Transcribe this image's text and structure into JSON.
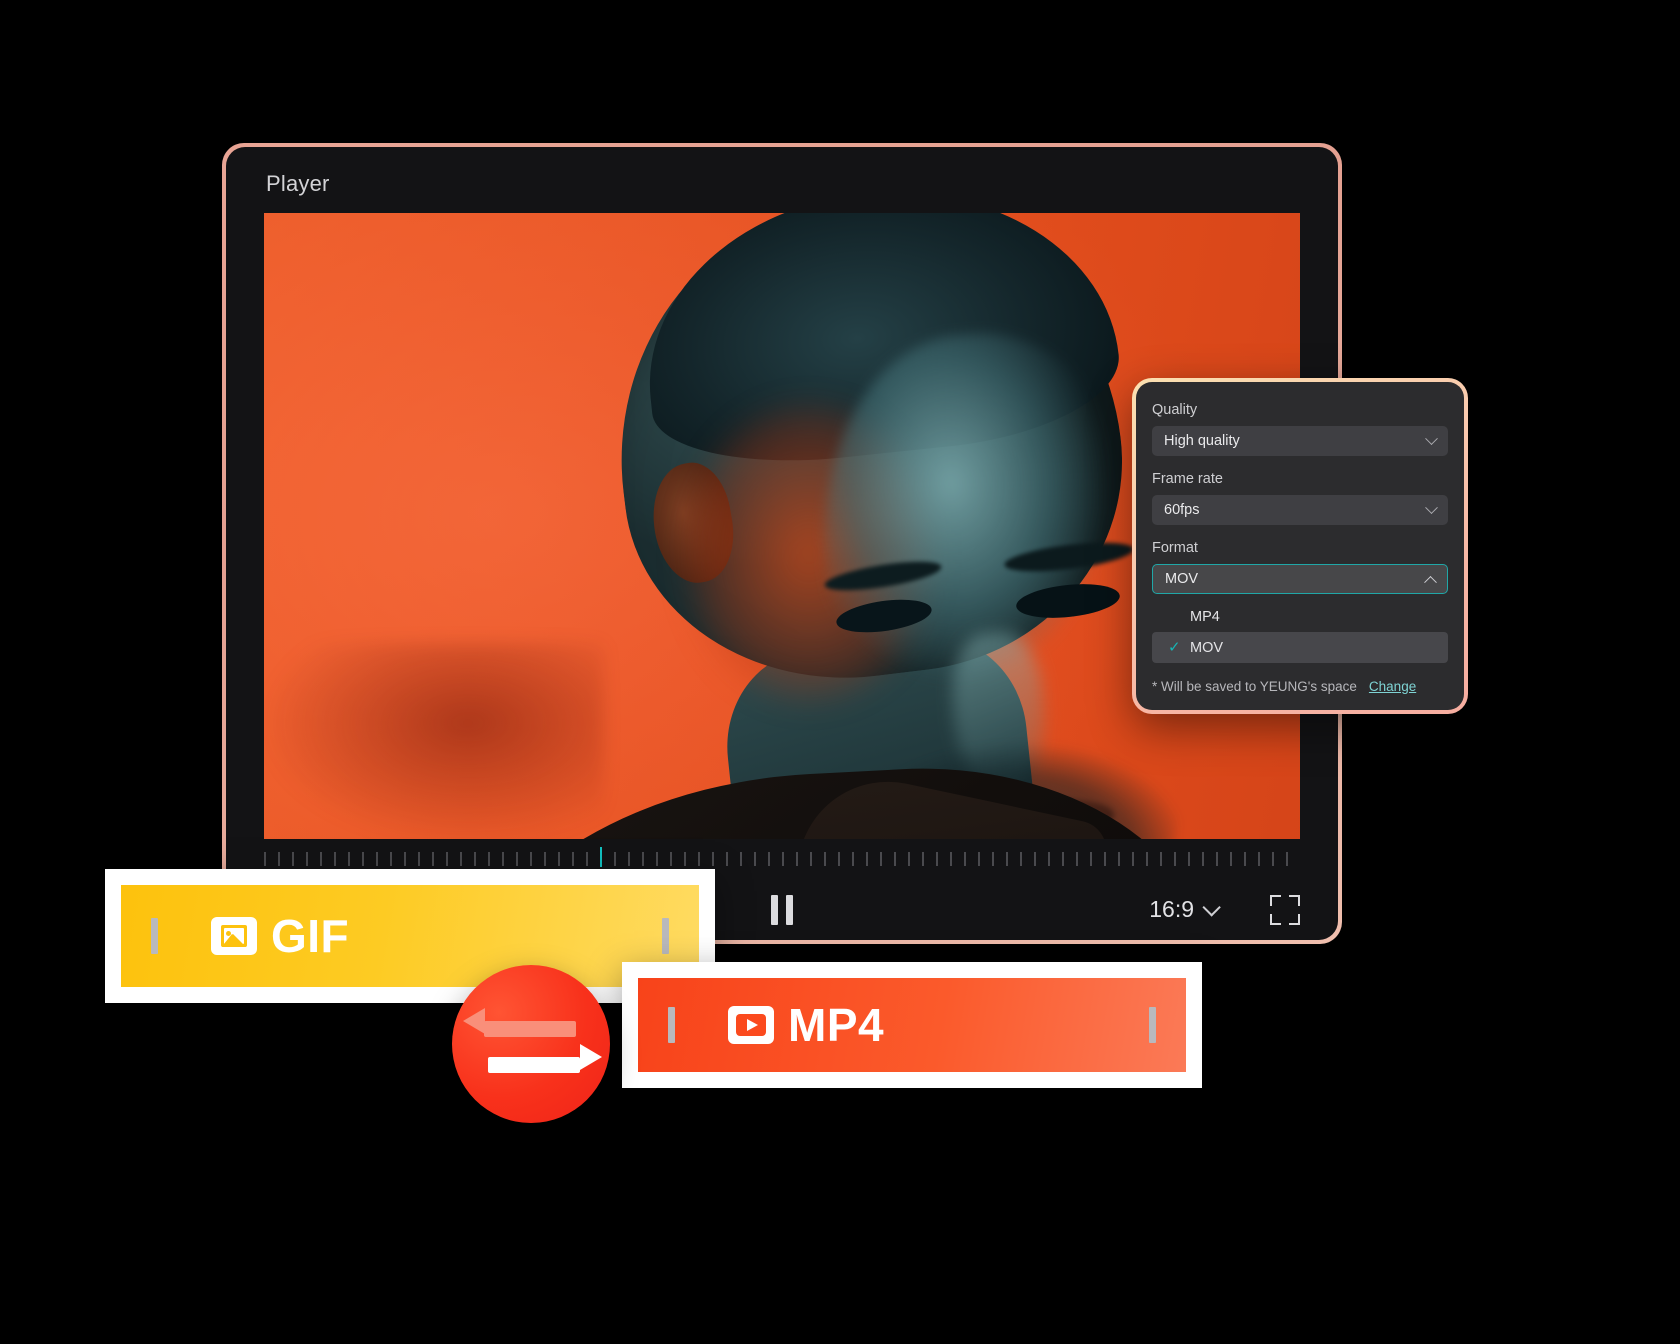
{
  "player": {
    "title": "Player",
    "controls": {
      "pause_label": "Pause",
      "aspect_ratio": "16:9",
      "fullscreen_label": "Fullscreen"
    }
  },
  "export_panel": {
    "quality": {
      "label": "Quality",
      "value": "High quality"
    },
    "frame_rate": {
      "label": "Frame rate",
      "value": "60fps"
    },
    "format": {
      "label": "Format",
      "value": "MOV",
      "options": [
        {
          "label": "MP4",
          "selected": false
        },
        {
          "label": "MOV",
          "selected": true
        }
      ]
    },
    "note": {
      "text": "* Will be saved to YEUNG's space",
      "link": "Change"
    }
  },
  "format_cards": [
    {
      "label": "GIF",
      "icon": "image-icon",
      "color": "#fdc20d"
    },
    {
      "label": "MP4",
      "icon": "video-play-icon",
      "color": "#fb4a1e"
    }
  ],
  "swap_button": {
    "label": "Swap formats",
    "color": "#f8311b"
  },
  "colors": {
    "accent_teal": "#16b5b5",
    "panel_bg": "#2c2c2e",
    "player_bg": "#131315",
    "gif_yellow": "#fdc20d",
    "mp4_orange": "#fb4a1e"
  }
}
